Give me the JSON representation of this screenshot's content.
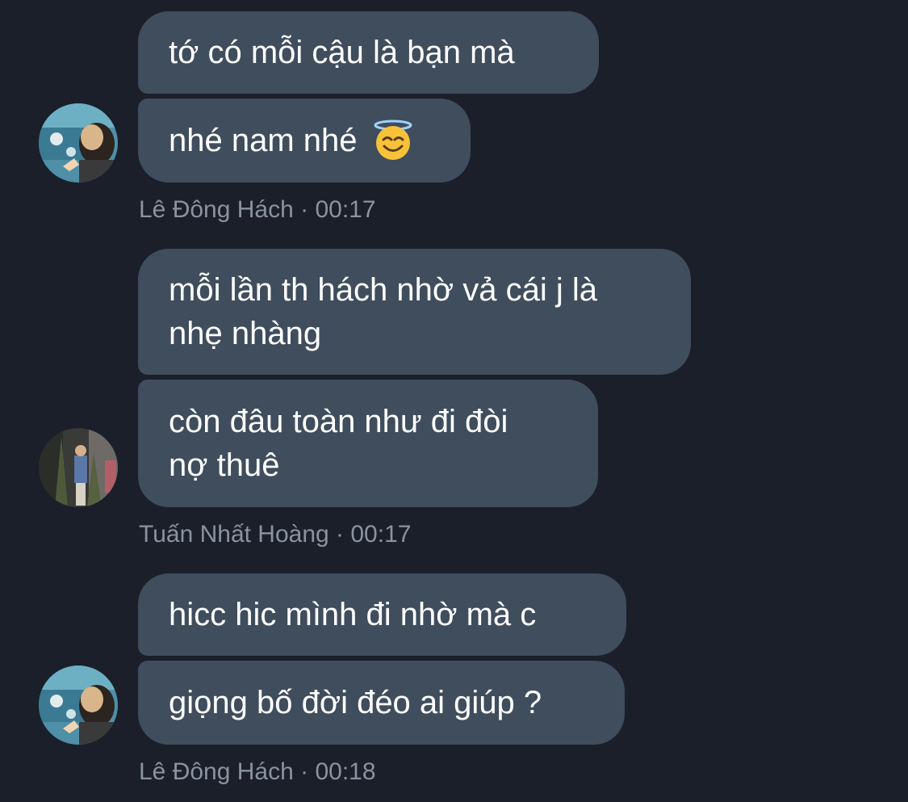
{
  "groups": [
    {
      "sender": "Lê Đông Hách",
      "time": "00:17",
      "meta_text": "Lê Đông Hách · 00:17",
      "avatar": "avatar-photo-aquarium",
      "messages": [
        {
          "text": "tớ có mỗi cậu là bạn mà"
        },
        {
          "text": "nhé nam nhé",
          "emoji": "smiling-face-with-halo-icon"
        }
      ]
    },
    {
      "sender": "Tuấn Nhất Hoàng",
      "time": "00:17",
      "meta_text": "Tuấn Nhất Hoàng · 00:17",
      "avatar": "avatar-photo-street",
      "messages": [
        {
          "text": "mỗi lần th hách nhờ vả cái j là\nnhẹ nhàng"
        },
        {
          "text": "còn đâu toàn như đi đòi\nnợ thuê"
        }
      ]
    },
    {
      "sender": "Lê Đông Hách",
      "time": "00:18",
      "meta_text": "Lê Đông Hách · 00:18",
      "avatar": "avatar-photo-aquarium",
      "messages": [
        {
          "text": "hicc hic mình đi nhờ mà c"
        },
        {
          "text": "giọng bố đời đéo ai giúp ?"
        }
      ]
    }
  ],
  "colors": {
    "background": "#1a1f2a",
    "bubble": "#3f4d5d",
    "text": "#ffffff",
    "meta": "#8a93a0"
  }
}
